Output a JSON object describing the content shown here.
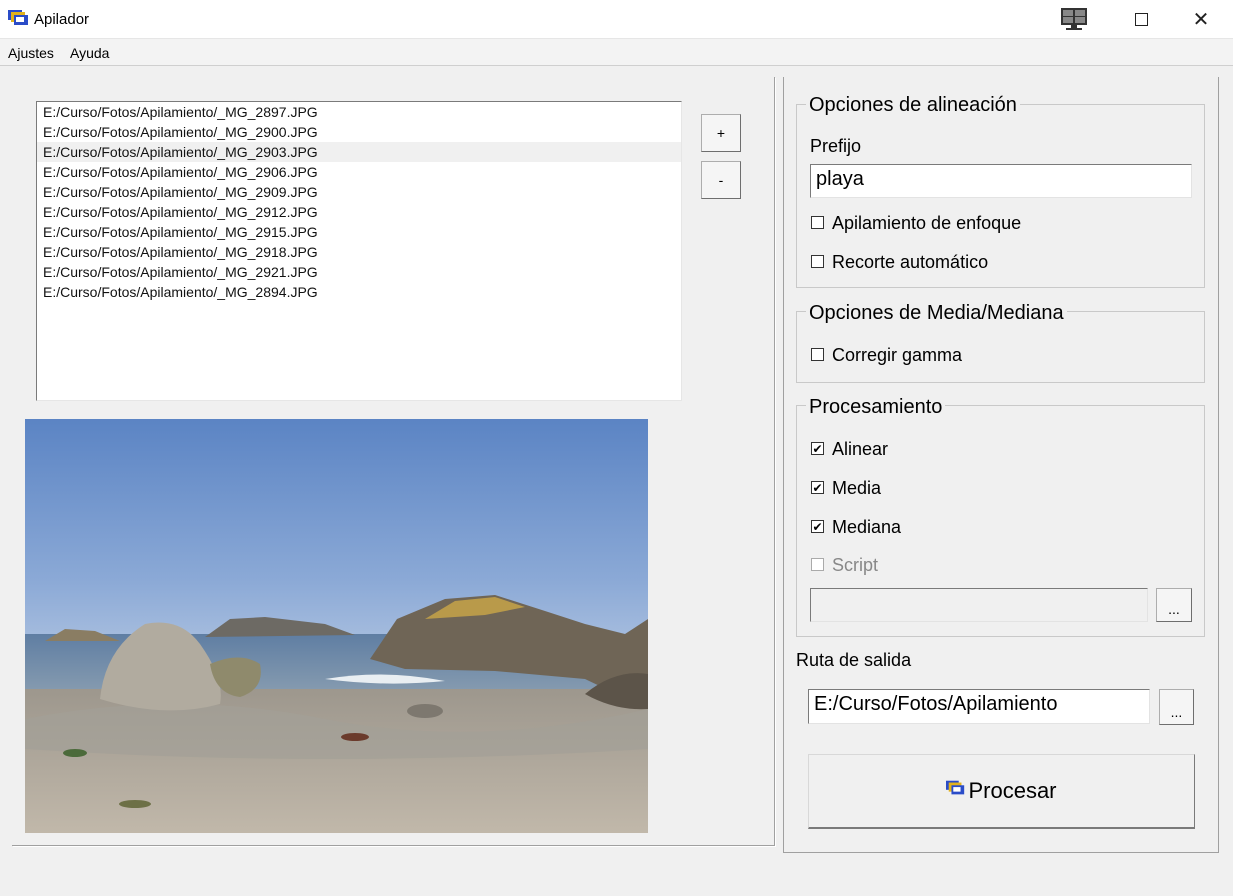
{
  "window": {
    "title": "Apilador",
    "icons": {
      "app": "app-icon",
      "monitor": "monitor-icon",
      "maximize": "maximize-icon",
      "close": "close-icon"
    }
  },
  "menu": [
    {
      "label": "Ajustes"
    },
    {
      "label": "Ayuda"
    }
  ],
  "files": [
    "E:/Curso/Fotos/Apilamiento/_MG_2897.JPG",
    "E:/Curso/Fotos/Apilamiento/_MG_2900.JPG",
    "E:/Curso/Fotos/Apilamiento/_MG_2903.JPG",
    "E:/Curso/Fotos/Apilamiento/_MG_2906.JPG",
    "E:/Curso/Fotos/Apilamiento/_MG_2909.JPG",
    "E:/Curso/Fotos/Apilamiento/_MG_2912.JPG",
    "E:/Curso/Fotos/Apilamiento/_MG_2915.JPG",
    "E:/Curso/Fotos/Apilamiento/_MG_2918.JPG",
    "E:/Curso/Fotos/Apilamiento/_MG_2921.JPG",
    "E:/Curso/Fotos/Apilamiento/_MG_2894.JPG"
  ],
  "selected_file_index": 2,
  "list_buttons": {
    "add": "+",
    "remove": "-"
  },
  "alignment": {
    "title": "Opciones de alineación",
    "prefix_label": "Prefijo",
    "prefix_value": "playa",
    "focus_stacking": {
      "label": "Apilamiento de enfoque",
      "checked": false
    },
    "auto_crop": {
      "label": "Recorte automático",
      "checked": false
    }
  },
  "mean_median": {
    "title": "Opciones de Media/Mediana",
    "gamma": {
      "label": "Corregir gamma",
      "checked": false
    }
  },
  "processing": {
    "title": "Procesamiento",
    "align": {
      "label": "Alinear",
      "checked": true
    },
    "mean": {
      "label": "Media",
      "checked": true
    },
    "median": {
      "label": "Mediana",
      "checked": true
    },
    "script": {
      "label": "Script",
      "checked": false,
      "enabled": false
    },
    "script_path": "",
    "browse": "..."
  },
  "output": {
    "label": "Ruta de salida",
    "value": "E:/Curso/Fotos/Apilamiento",
    "browse": "..."
  },
  "process_button": {
    "label": "Procesar"
  }
}
